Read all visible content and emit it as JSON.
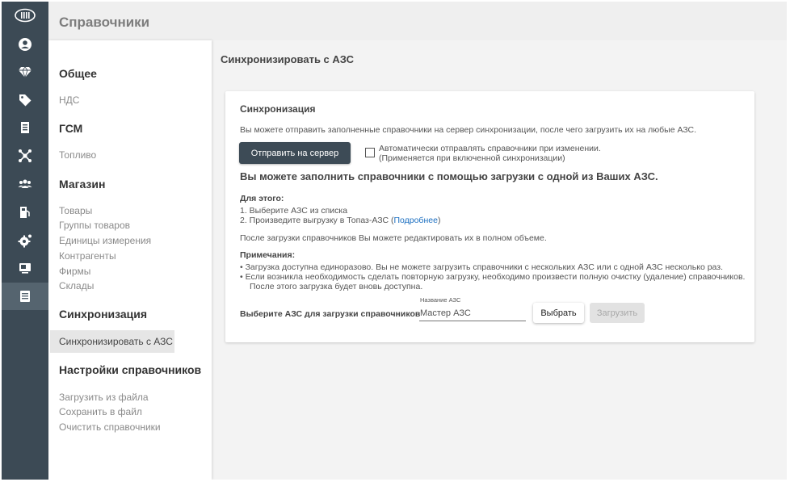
{
  "header": {
    "title": "Справочники"
  },
  "rail": {
    "icons": [
      "topaz-logo-icon",
      "user-icon",
      "diamond-icon",
      "tag-icon",
      "document-icon",
      "network-icon",
      "group-icon",
      "fuel-station-icon",
      "gear-icon",
      "monitor-icon",
      "list-icon"
    ],
    "active_index": 10
  },
  "subnav": {
    "general": {
      "title": "Общее",
      "items": [
        "НДС"
      ]
    },
    "fuel": {
      "title": "ГСМ",
      "items": [
        "Топливо"
      ]
    },
    "shop": {
      "title": "Магазин",
      "items": [
        "Товары",
        "Группы товаров",
        "Единицы измерения",
        "Контрагенты",
        "Фирмы",
        "Склады"
      ]
    },
    "sync": {
      "title": "Синхронизация",
      "items": [
        "Синхронизировать с АЗС"
      ]
    },
    "settings": {
      "title": "Настройки справочников",
      "items": [
        "Загрузить из файла",
        "Сохранить в файл",
        "Очистить справочники"
      ]
    }
  },
  "main": {
    "title": "Синхронизировать с АЗС",
    "card": {
      "title": "Синхронизация",
      "description": "Вы можете отправить заполненные справочники на сервер синхронизации, после чего загрузить их на любые АЗС.",
      "send_button": "Отправить на сервер",
      "auto_checkbox": {
        "line1": "Автоматически отправлять справочники при изменении.",
        "line2": "(Применяется при включенной синхронизации)",
        "checked": false
      },
      "headline": "Вы можете заполнить справочники с помощью загрузки с одной из Ваших АЗС.",
      "steps_title": "Для этого:",
      "step1": "1. Выберите АЗС из списка",
      "step2_prefix": "2. Произведите выгрузку в Топаз-АЗС (",
      "step2_link": "Подробнее",
      "step2_suffix": ")",
      "after_load": "После загрузки справочников Вы можете редактировать их в полном объеме.",
      "notes_title": "Примечания:",
      "note1": "• Загрузка доступна единоразово. Вы не можете загрузить справочники с нескольких АЗС или с одной АЗС несколько раз.",
      "note2_line1": "• Если возникла необходимость сделать повторную загрузку, необходимо произвести полную очистку (удаление) справочников.",
      "note2_line2": "После этого загрузка будет вновь доступна.",
      "select_label": "Выберите АЗС для загрузки справочников",
      "station_field": {
        "label": "Название АЗС",
        "value": "Мастер АЗС"
      },
      "pick_button": "Выбрать",
      "load_button": "Загрузить"
    }
  }
}
